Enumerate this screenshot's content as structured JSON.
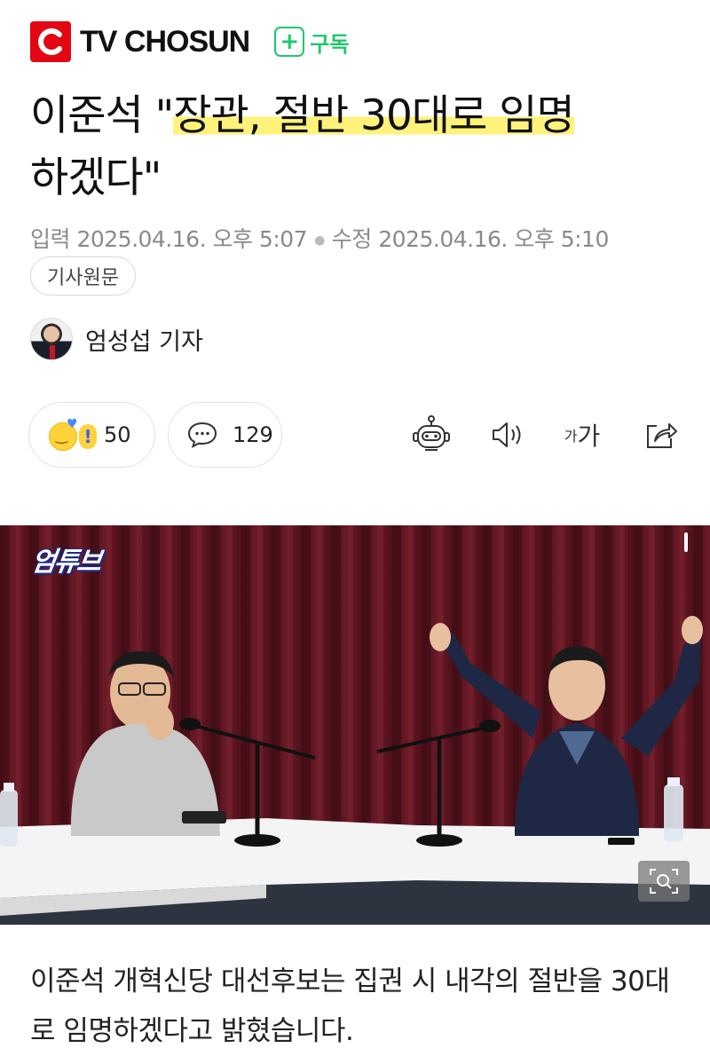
{
  "header": {
    "brand": "TV CHOSUN",
    "subscribe_label": "구독"
  },
  "article": {
    "title_part1": "이준석 \"",
    "title_highlight": "장관, 절반 30대로 임명",
    "title_part2": "하겠다\"",
    "input_date": "입력 2025.04.16. 오후 5:07",
    "edit_date": "수정 2025.04.16. 오후 5:10",
    "original_button": "기사원문",
    "reporter": "엄성섭 기자",
    "body": "이준석 개혁신당 대선후보는 집권 시 내각의 절반을 30대로 임명하겠다고 밝혔습니다."
  },
  "actions": {
    "reaction_count": "50",
    "comment_count": "129",
    "font_small": "가",
    "font_large": "가"
  },
  "photo": {
    "badge": "엄튜브"
  },
  "colors": {
    "brand_red": "#e30613",
    "subscribe_green": "#1ec86a",
    "highlight_yellow": "#fff27a",
    "curtain": "#5a1620"
  }
}
